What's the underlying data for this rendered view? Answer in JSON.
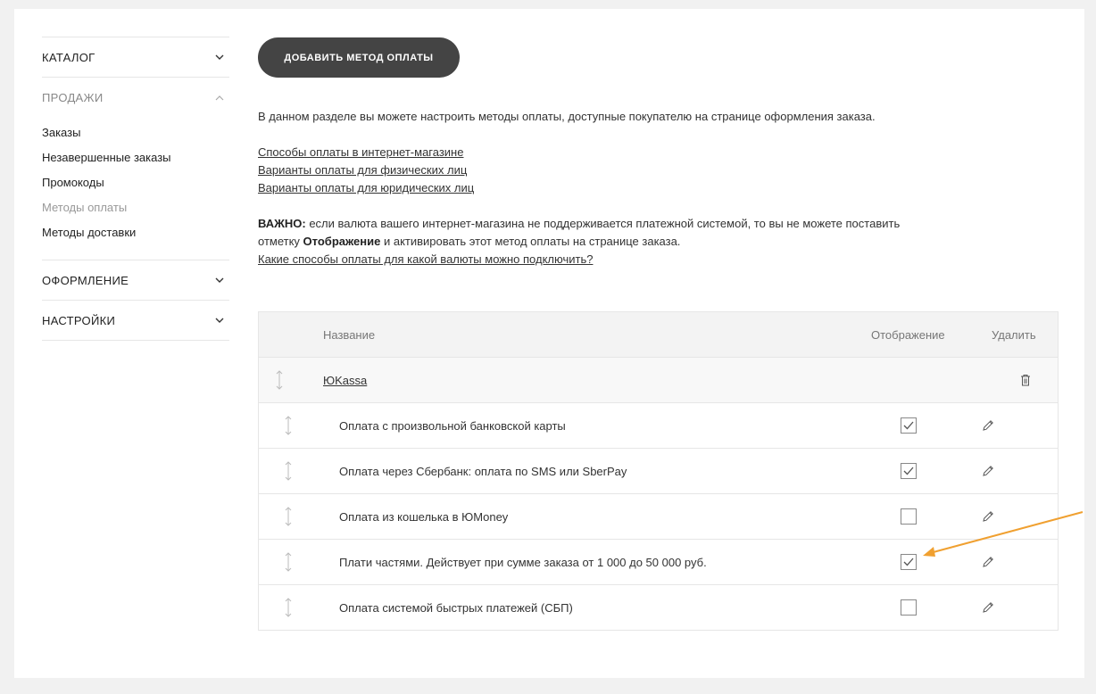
{
  "sidebar": {
    "catalog": "КАТАЛОГ",
    "sales": "ПРОДАЖИ",
    "sales_items": [
      "Заказы",
      "Незавершенные заказы",
      "Промокоды",
      "Методы оплаты",
      "Методы доставки"
    ],
    "design": "ОФОРМЛЕНИЕ",
    "settings": "НАСТРОЙКИ"
  },
  "main": {
    "add_button": "ДОБАВИТЬ МЕТОД ОПЛАТЫ",
    "intro": "В данном разделе вы можете настроить методы оплаты, доступные покупателю на странице оформления заказа.",
    "links": [
      "Способы оплаты в интернет-магазине",
      "Варианты оплаты для физических лиц",
      "Варианты оплаты для юридических лиц"
    ],
    "warn_bold": "ВАЖНО:",
    "warn_text_1": " если валюта вашего интернет-магазина не поддерживается платежной системой, то вы не можете поставить отметку ",
    "warn_bold_2": "Отображение",
    "warn_text_2": " и активировать этот метод оплаты на странице заказа.",
    "warn_link": "Какие способы оплаты для какой валюты можно подключить?"
  },
  "table": {
    "col_name": "Название",
    "col_show": "Отображение",
    "col_delete": "Удалить",
    "group": "ЮKassa",
    "rows": [
      {
        "name": "Оплата с произвольной банковской карты",
        "checked": true
      },
      {
        "name": "Оплата через Сбербанк: оплата по SMS или SberPay",
        "checked": true
      },
      {
        "name": "Оплата из кошелька в ЮMoney",
        "checked": false
      },
      {
        "name": "Плати частями. Действует при сумме заказа от 1 000 до 50 000 руб.",
        "checked": true
      },
      {
        "name": "Оплата системой быстрых платежей (СБП)",
        "checked": false
      }
    ]
  },
  "colors": {
    "accent_arrow": "#f0a030",
    "button_bg": "#444444"
  }
}
